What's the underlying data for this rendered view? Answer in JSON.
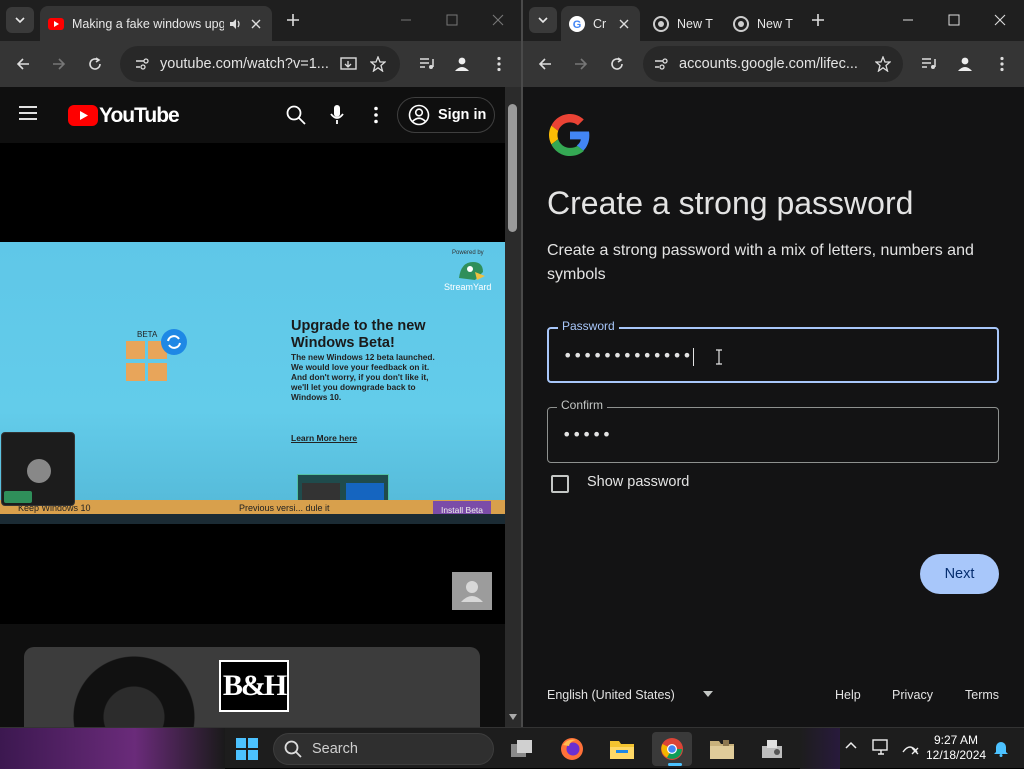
{
  "left_window": {
    "tab_title": "Making a fake windows upgrade",
    "url": "youtube.com/watch?v=1...",
    "youtube": {
      "logo_text": "YouTube",
      "signin_label": "Sign in",
      "video": {
        "powered_by": "Powered by",
        "brand": "StreamYard",
        "beta_label": "BETA",
        "headline": "Upgrade to the new Windows Beta!",
        "body": "The new Windows 12 beta launched. We would love your feedback on it. And don't worry, if you don't like it, we'll let you downgrade back to Windows 10.",
        "learn_more": "Learn More here",
        "keep_label": "Keep Windows 10",
        "previous_label": "Previous versi... dule it",
        "install_label": "Install Beta"
      },
      "feed_logo": "B&H"
    }
  },
  "right_window": {
    "tabs": [
      {
        "label": "Cr"
      },
      {
        "label": "New T"
      },
      {
        "label": "New T"
      }
    ],
    "url": "accounts.google.com/lifec...",
    "page": {
      "title": "Create a strong password",
      "subtitle": "Create a strong password with a mix of letters, numbers and symbols",
      "password_label": "Password",
      "password_value": "•••••••••••••",
      "confirm_label": "Confirm",
      "confirm_value": "•••••",
      "show_password_label": "Show password",
      "show_password_checked": false,
      "next_label": "Next"
    },
    "footer": {
      "language": "English (United States)",
      "links": [
        "Help",
        "Privacy",
        "Terms"
      ]
    }
  },
  "taskbar": {
    "search_label": "Search",
    "time": "9:27 AM",
    "date": "12/18/2024",
    "pinned": [
      "task-view-icon",
      "firefox-icon",
      "file-explorer-icon",
      "chrome-icon",
      "folder-icon",
      "app-icon"
    ]
  },
  "colors": {
    "youtube_red": "#ff0000",
    "google_blue": "#4285f4",
    "google_red": "#ea4335",
    "google_yellow": "#fbbc05",
    "google_green": "#34a853",
    "accent": "#a8c7fa"
  }
}
